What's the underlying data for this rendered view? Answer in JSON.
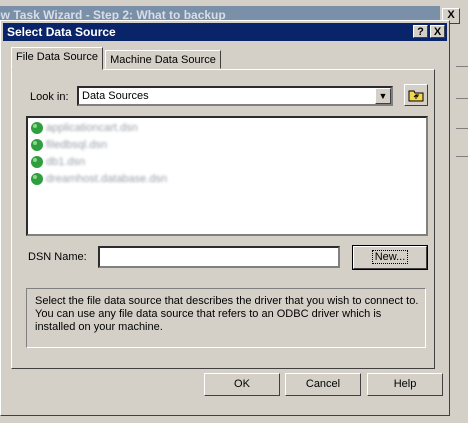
{
  "background_window": {
    "title": "ew Task Wizard - Step 2: What to backup",
    "close_label": "X"
  },
  "dialog": {
    "title": "Select Data Source",
    "help_label": "?",
    "close_label": "X"
  },
  "tabs": [
    {
      "label": "File Data Source",
      "active": true
    },
    {
      "label": "Machine Data Source",
      "active": false
    }
  ],
  "look_in": {
    "label": "Look in:",
    "value": "Data Sources"
  },
  "files": [
    "applicationcart.dsn",
    "filedbsql.dsn",
    "db1.dsn",
    "dreamhost.database.dsn"
  ],
  "dsn": {
    "label": "DSN Name:",
    "value": "",
    "new_label": "New..."
  },
  "description": "Select the file data source that describes the driver that you wish to connect to. You can use any file data source that refers to an ODBC driver which is installed on your machine.",
  "buttons": {
    "ok": "OK",
    "cancel": "Cancel",
    "help": "Help"
  },
  "colors": {
    "titlebar": "#0a246a",
    "face": "#d4d0c8",
    "folder_icon": "#f2d64b",
    "db_icon": "#2e9e3e"
  }
}
